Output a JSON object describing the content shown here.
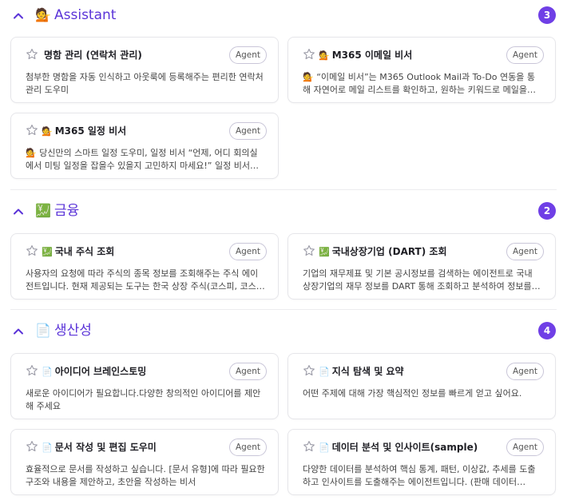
{
  "sections": [
    {
      "emoji": "💁",
      "title": "Assistant",
      "count": "3",
      "cards": [
        {
          "emoji": "",
          "title": "명함 관리 (연락처 관리)",
          "badge": "Agent",
          "desc": "첨부한 명함을 자동 인식하고 아웃룩에 등록해주는 편리한 연락처 관리 도우미"
        },
        {
          "emoji": "💁",
          "title": "M365 이메일 비서",
          "badge": "Agent",
          "desc": "💁 “이메일 비서”는 M365 Outlook Mail과 To-Do 연동을 통해 자연어로 메일 리스트를 확인하고, 원하는 키워드로 메일을 검…"
        },
        {
          "emoji": "💁",
          "title": "M365 일정 비서",
          "badge": "Agent",
          "desc": "💁 당신만의 스마트 일정 도우미, 일정 비서 “언제, 어디 회의실에서 미팅 일정을 잡을수 있을지 고민하지 마세요!” 일정 비서…"
        }
      ]
    },
    {
      "emoji": "💹",
      "title": "금융",
      "count": "2",
      "cards": [
        {
          "emoji": "💹",
          "title": "국내 주식 조회",
          "badge": "Agent",
          "desc": "사용자의 요청에 따라 주식의 종목 정보를 조회해주는 주식 에이전트입니다. 현재 제공되는 도구는 한국 상장 주식(코스피, 코스…"
        },
        {
          "emoji": "💹",
          "title": "국내상장기업 (DART) 조회",
          "badge": "Agent",
          "desc": "기업의 재무제표 및 기본 공시정보를 검색하는 에이전트로 국내 상장기업의 재무 정보를 DART 통해 조회하고 분석하여 정보를 …"
        }
      ]
    },
    {
      "emoji": "📄",
      "title": "생산성",
      "count": "4",
      "cards": [
        {
          "emoji": "📄",
          "title": "아이디어 브레인스토밍",
          "badge": "Agent",
          "desc": "새로운 아이디어가 필요합니다.다양한 창의적인 아이디어를 제안해 주세요"
        },
        {
          "emoji": "📄",
          "title": "지식 탐색 및 요약",
          "badge": "Agent",
          "desc": "어떤 주제에 대해 가장 핵심적인 정보를 빠르게 얻고 싶어요."
        },
        {
          "emoji": "📄",
          "title": "문서 작성 및 편집 도우미",
          "badge": "Agent",
          "desc": "효율적으로 문서를 작성하고 싶습니다. [문서 유형]에 따라 필요한 구조와 내용을 제안하고, 초안을 작성하는 비서"
        },
        {
          "emoji": "📄",
          "title": "데이터 분석 및 인사이트(sample)",
          "badge": "Agent",
          "desc": "다양한 데이터를 분석하여 핵심 통계, 패턴, 이상값, 추세를 도출하고 인사이트를 도출해주는 에이전트입니다. (판매 데이터…"
        }
      ]
    }
  ]
}
